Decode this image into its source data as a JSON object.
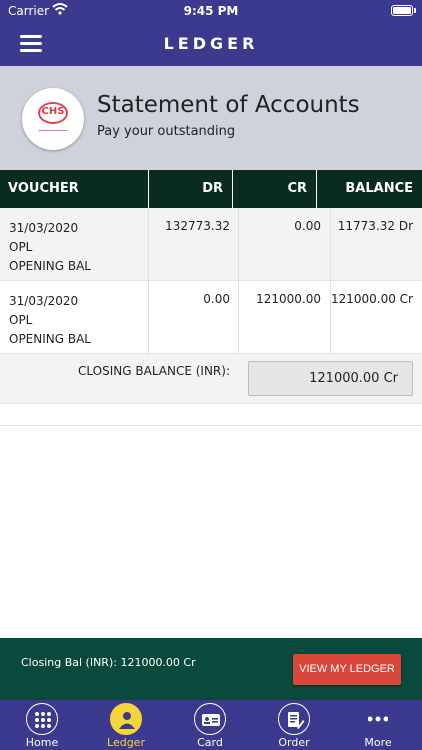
{
  "status_bar": {
    "carrier": "Carrier",
    "time": "9:45 PM"
  },
  "nav": {
    "title": "LEDGER",
    "menu_icon": "hamburger-menu-icon"
  },
  "header": {
    "title": "Statement of Accounts",
    "subtitle": "Pay your outstanding",
    "logo_text": "CHS"
  },
  "table": {
    "columns": [
      "VOUCHER",
      "DR",
      "CR",
      "BALANCE"
    ],
    "rows": [
      {
        "date": "31/03/2020",
        "type": "OPL",
        "narration": "OPENING BAL",
        "dr": "132773.32",
        "cr": "0.00",
        "balance": "11773.32 Dr"
      },
      {
        "date": "31/03/2020",
        "type": "OPL",
        "narration": "OPENING BAL",
        "dr": "0.00",
        "cr": "121000.00",
        "balance": "121000.00 Cr"
      }
    ],
    "closing_label": "CLOSING BALANCE (INR):",
    "closing_value": "121000.00 Cr"
  },
  "footer": {
    "closing_bal": "Closing Bal (INR): 121000.00 Cr",
    "button_label": "VIEW MY LEDGER"
  },
  "tabs": [
    {
      "label": "Home",
      "icon": "grid-icon",
      "active": false
    },
    {
      "label": "Ledger",
      "icon": "user-icon",
      "active": true
    },
    {
      "label": "Card",
      "icon": "id-card-icon",
      "active": false
    },
    {
      "label": "Order",
      "icon": "order-icon",
      "active": false
    },
    {
      "label": "More",
      "icon": "more-dots-icon",
      "active": false
    }
  ],
  "colors": {
    "brand": "#3b3a8e",
    "table_header": "#0a2b1f",
    "footer": "#0a4a3c",
    "button": "#d8473a",
    "active_tab": "#f5d63a"
  }
}
